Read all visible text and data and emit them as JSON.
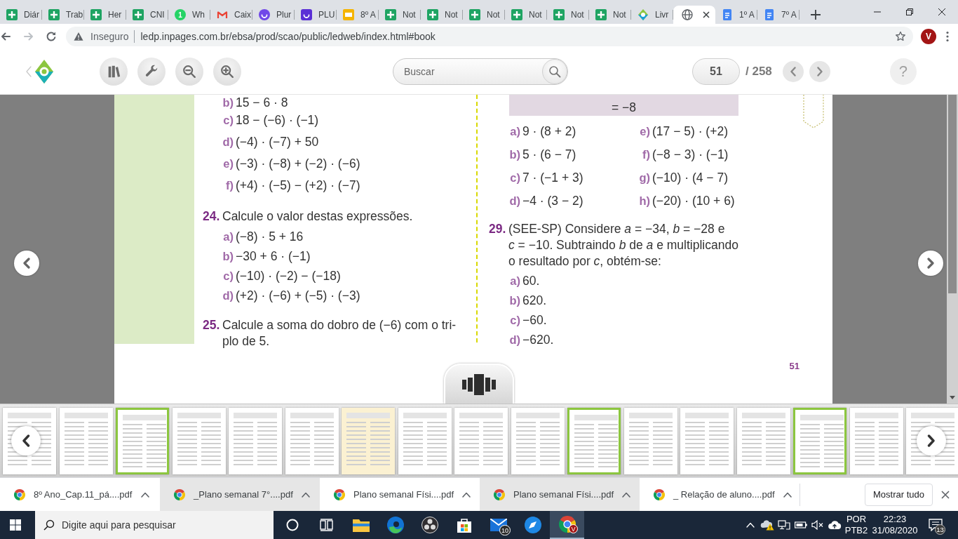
{
  "tabs": [
    {
      "title": "Diár",
      "kind": "sheet",
      "selected": false
    },
    {
      "title": "Trab",
      "kind": "sheet",
      "selected": false
    },
    {
      "title": "Her",
      "kind": "sheet",
      "selected": false
    },
    {
      "title": "CNI",
      "kind": "sheet",
      "selected": false
    },
    {
      "title": "Wh",
      "kind": "count",
      "icon_text": "1",
      "selected": false
    },
    {
      "title": "Caix",
      "kind": "mail",
      "selected": false
    },
    {
      "title": "Plur",
      "kind": "smiley-round",
      "selected": false
    },
    {
      "title": "PLU",
      "kind": "smiley-square",
      "selected": false
    },
    {
      "title": "8º A",
      "kind": "slides",
      "selected": false
    },
    {
      "title": "Not",
      "kind": "sheet",
      "selected": false
    },
    {
      "title": "Not",
      "kind": "sheet",
      "selected": false
    },
    {
      "title": "Not",
      "kind": "sheet",
      "selected": false
    },
    {
      "title": "Not",
      "kind": "sheet",
      "selected": false
    },
    {
      "title": "Not",
      "kind": "sheet",
      "selected": false
    },
    {
      "title": "Not",
      "kind": "sheet",
      "selected": false
    },
    {
      "title": "Livr",
      "kind": "logo",
      "selected": false
    },
    {
      "kind": "globe",
      "selected": true
    },
    {
      "title": "1º A",
      "kind": "doc",
      "selected": false
    },
    {
      "title": "7º A",
      "kind": "doc",
      "selected": false
    }
  ],
  "address_bar": {
    "back_disabled": false,
    "forward_disabled": true,
    "security_label": "Inseguro",
    "url": "ledp.inpages.com.br/ebsa/prod/scao/public/ledweb/index.html#book",
    "profile_initial": "V"
  },
  "reader_toolbar": {
    "search_placeholder": "Buscar",
    "page_value": "51",
    "page_total": "/ 258",
    "help_label": "?"
  },
  "book_page": {
    "left_column": {
      "continued_items": [
        {
          "label": "b)",
          "expression": "15 − 6 · 8"
        },
        {
          "label": "c)",
          "expression": "18 − (−6) · (−1)"
        },
        {
          "label": "d)",
          "expression": "(−4) · (−7) + 50"
        },
        {
          "label": "e)",
          "expression": "(−3) · (−8) + (−2) · (−6)"
        },
        {
          "label": "f)",
          "expression": "(+4) · (−5) − (+2) · (−7)"
        }
      ],
      "exercises": [
        {
          "number": "24.",
          "prompt_lines": [
            "Calcule o valor destas expressões."
          ],
          "items": [
            {
              "label": "a)",
              "expression": "(−8) · 5 + 16"
            },
            {
              "label": "b)",
              "expression": "−30 + 6 · (−1)"
            },
            {
              "label": "c)",
              "expression": "(−10) · (−2) − (−18)"
            },
            {
              "label": "d)",
              "expression": "(+2) · (−6) + (−5) · (−3)"
            }
          ]
        },
        {
          "number": "25.",
          "prompt_lines": [
            "Calcule a soma do dobro de (−6) com o tri-",
            "plo de 5."
          ]
        }
      ]
    },
    "right_column": {
      "example_result": "= −8",
      "items": [
        {
          "label": "a)",
          "expression": "9 · (8 + 2)"
        },
        {
          "label": "b)",
          "expression": "5 · (6 − 7)"
        },
        {
          "label": "c)",
          "expression": "7 · (−1 + 3)"
        },
        {
          "label": "d)",
          "expression": "−4 · (3 − 2)"
        },
        {
          "label": "e)",
          "expression": "(17 − 5) · (+2)"
        },
        {
          "label": "f)",
          "expression": "(−8 − 3) · (−1)"
        },
        {
          "label": "g)",
          "expression": "(−10) · (4 − 7)"
        },
        {
          "label": "h)",
          "expression": "(−20) · (10 + 6)"
        }
      ],
      "exercise": {
        "number": "29.",
        "prompt_lines": [
          "(SEE-SP) Considere *a* = −34, *b* = −28 e",
          "*c* = −10. Subtraindo *b* de *a* e multiplicando",
          "o resultado por *c*, obtém-se:"
        ],
        "options": [
          {
            "label": "a)",
            "text": "60."
          },
          {
            "label": "b)",
            "text": "620."
          },
          {
            "label": "c)",
            "text": "−60."
          },
          {
            "label": "d)",
            "text": "−620."
          }
        ]
      }
    },
    "page_number": "51"
  },
  "thumbnails": [
    {
      "kind": "plain"
    },
    {
      "kind": "plain"
    },
    {
      "kind": "framed"
    },
    {
      "kind": "plain"
    },
    {
      "kind": "plain"
    },
    {
      "kind": "plain"
    },
    {
      "kind": "tinted"
    },
    {
      "kind": "plain"
    },
    {
      "kind": "plain"
    },
    {
      "kind": "plain"
    },
    {
      "kind": "framed"
    },
    {
      "kind": "plain"
    },
    {
      "kind": "plain"
    },
    {
      "kind": "plain"
    },
    {
      "kind": "framed"
    },
    {
      "kind": "plain"
    },
    {
      "kind": "plain"
    }
  ],
  "downloads": {
    "items": [
      {
        "filename": "8º Ano_Cap.11_pá....pdf",
        "highlighted": false
      },
      {
        "filename": "_Plano semanal 7°....pdf",
        "highlighted": true
      },
      {
        "filename": "Plano semanal Físi....pdf",
        "highlighted": false
      },
      {
        "filename": "Plano semanal Físi....pdf",
        "highlighted": true
      },
      {
        "filename": "_ Relação de aluno....pdf",
        "highlighted": false
      }
    ],
    "show_all": "Mostrar tudo"
  },
  "taskbar": {
    "search_placeholder": "Digite aqui para pesquisar",
    "apps": [
      {
        "kind": "ring",
        "selected": false
      },
      {
        "kind": "task-view",
        "selected": false
      },
      {
        "kind": "folder",
        "selected": false
      },
      {
        "kind": "swirl",
        "selected": false
      },
      {
        "kind": "three-circles",
        "selected": false
      },
      {
        "kind": "bag",
        "selected": false
      },
      {
        "kind": "mail",
        "badge": "10",
        "selected": false
      },
      {
        "kind": "compass",
        "selected": false
      },
      {
        "kind": "browser",
        "badge": "V",
        "selected": true
      }
    ],
    "tray": {
      "language": "POR",
      "layout": "PTB2",
      "time": "22:23",
      "date": "31/08/2020",
      "notifications": "13"
    }
  }
}
